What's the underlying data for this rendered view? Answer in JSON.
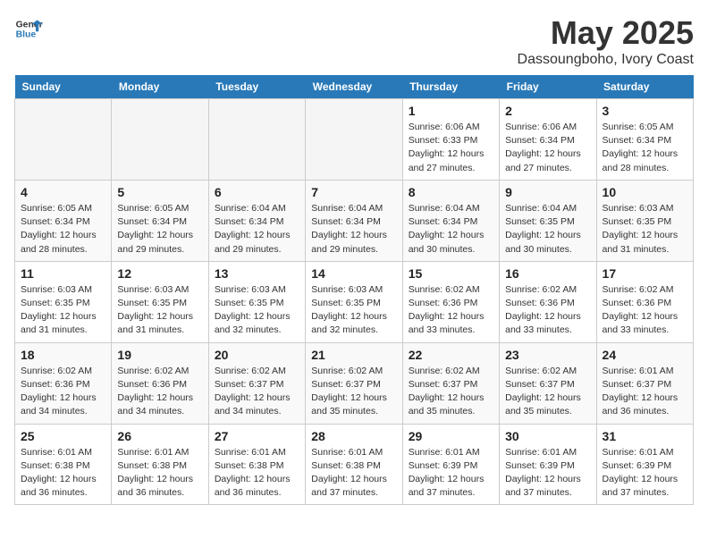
{
  "logo": {
    "line1": "General",
    "line2": "Blue"
  },
  "title": "May 2025",
  "location": "Dassoungboho, Ivory Coast",
  "days_of_week": [
    "Sunday",
    "Monday",
    "Tuesday",
    "Wednesday",
    "Thursday",
    "Friday",
    "Saturday"
  ],
  "weeks": [
    [
      {
        "day": "",
        "empty": true
      },
      {
        "day": "",
        "empty": true
      },
      {
        "day": "",
        "empty": true
      },
      {
        "day": "",
        "empty": true
      },
      {
        "day": "1",
        "info": "Sunrise: 6:06 AM\nSunset: 6:33 PM\nDaylight: 12 hours\nand 27 minutes."
      },
      {
        "day": "2",
        "info": "Sunrise: 6:06 AM\nSunset: 6:34 PM\nDaylight: 12 hours\nand 27 minutes."
      },
      {
        "day": "3",
        "info": "Sunrise: 6:05 AM\nSunset: 6:34 PM\nDaylight: 12 hours\nand 28 minutes."
      }
    ],
    [
      {
        "day": "4",
        "info": "Sunrise: 6:05 AM\nSunset: 6:34 PM\nDaylight: 12 hours\nand 28 minutes."
      },
      {
        "day": "5",
        "info": "Sunrise: 6:05 AM\nSunset: 6:34 PM\nDaylight: 12 hours\nand 29 minutes."
      },
      {
        "day": "6",
        "info": "Sunrise: 6:04 AM\nSunset: 6:34 PM\nDaylight: 12 hours\nand 29 minutes."
      },
      {
        "day": "7",
        "info": "Sunrise: 6:04 AM\nSunset: 6:34 PM\nDaylight: 12 hours\nand 29 minutes."
      },
      {
        "day": "8",
        "info": "Sunrise: 6:04 AM\nSunset: 6:34 PM\nDaylight: 12 hours\nand 30 minutes."
      },
      {
        "day": "9",
        "info": "Sunrise: 6:04 AM\nSunset: 6:35 PM\nDaylight: 12 hours\nand 30 minutes."
      },
      {
        "day": "10",
        "info": "Sunrise: 6:03 AM\nSunset: 6:35 PM\nDaylight: 12 hours\nand 31 minutes."
      }
    ],
    [
      {
        "day": "11",
        "info": "Sunrise: 6:03 AM\nSunset: 6:35 PM\nDaylight: 12 hours\nand 31 minutes."
      },
      {
        "day": "12",
        "info": "Sunrise: 6:03 AM\nSunset: 6:35 PM\nDaylight: 12 hours\nand 31 minutes."
      },
      {
        "day": "13",
        "info": "Sunrise: 6:03 AM\nSunset: 6:35 PM\nDaylight: 12 hours\nand 32 minutes."
      },
      {
        "day": "14",
        "info": "Sunrise: 6:03 AM\nSunset: 6:35 PM\nDaylight: 12 hours\nand 32 minutes."
      },
      {
        "day": "15",
        "info": "Sunrise: 6:02 AM\nSunset: 6:36 PM\nDaylight: 12 hours\nand 33 minutes."
      },
      {
        "day": "16",
        "info": "Sunrise: 6:02 AM\nSunset: 6:36 PM\nDaylight: 12 hours\nand 33 minutes."
      },
      {
        "day": "17",
        "info": "Sunrise: 6:02 AM\nSunset: 6:36 PM\nDaylight: 12 hours\nand 33 minutes."
      }
    ],
    [
      {
        "day": "18",
        "info": "Sunrise: 6:02 AM\nSunset: 6:36 PM\nDaylight: 12 hours\nand 34 minutes."
      },
      {
        "day": "19",
        "info": "Sunrise: 6:02 AM\nSunset: 6:36 PM\nDaylight: 12 hours\nand 34 minutes."
      },
      {
        "day": "20",
        "info": "Sunrise: 6:02 AM\nSunset: 6:37 PM\nDaylight: 12 hours\nand 34 minutes."
      },
      {
        "day": "21",
        "info": "Sunrise: 6:02 AM\nSunset: 6:37 PM\nDaylight: 12 hours\nand 35 minutes."
      },
      {
        "day": "22",
        "info": "Sunrise: 6:02 AM\nSunset: 6:37 PM\nDaylight: 12 hours\nand 35 minutes."
      },
      {
        "day": "23",
        "info": "Sunrise: 6:02 AM\nSunset: 6:37 PM\nDaylight: 12 hours\nand 35 minutes."
      },
      {
        "day": "24",
        "info": "Sunrise: 6:01 AM\nSunset: 6:37 PM\nDaylight: 12 hours\nand 36 minutes."
      }
    ],
    [
      {
        "day": "25",
        "info": "Sunrise: 6:01 AM\nSunset: 6:38 PM\nDaylight: 12 hours\nand 36 minutes."
      },
      {
        "day": "26",
        "info": "Sunrise: 6:01 AM\nSunset: 6:38 PM\nDaylight: 12 hours\nand 36 minutes."
      },
      {
        "day": "27",
        "info": "Sunrise: 6:01 AM\nSunset: 6:38 PM\nDaylight: 12 hours\nand 36 minutes."
      },
      {
        "day": "28",
        "info": "Sunrise: 6:01 AM\nSunset: 6:38 PM\nDaylight: 12 hours\nand 37 minutes."
      },
      {
        "day": "29",
        "info": "Sunrise: 6:01 AM\nSunset: 6:39 PM\nDaylight: 12 hours\nand 37 minutes."
      },
      {
        "day": "30",
        "info": "Sunrise: 6:01 AM\nSunset: 6:39 PM\nDaylight: 12 hours\nand 37 minutes."
      },
      {
        "day": "31",
        "info": "Sunrise: 6:01 AM\nSunset: 6:39 PM\nDaylight: 12 hours\nand 37 minutes."
      }
    ]
  ]
}
